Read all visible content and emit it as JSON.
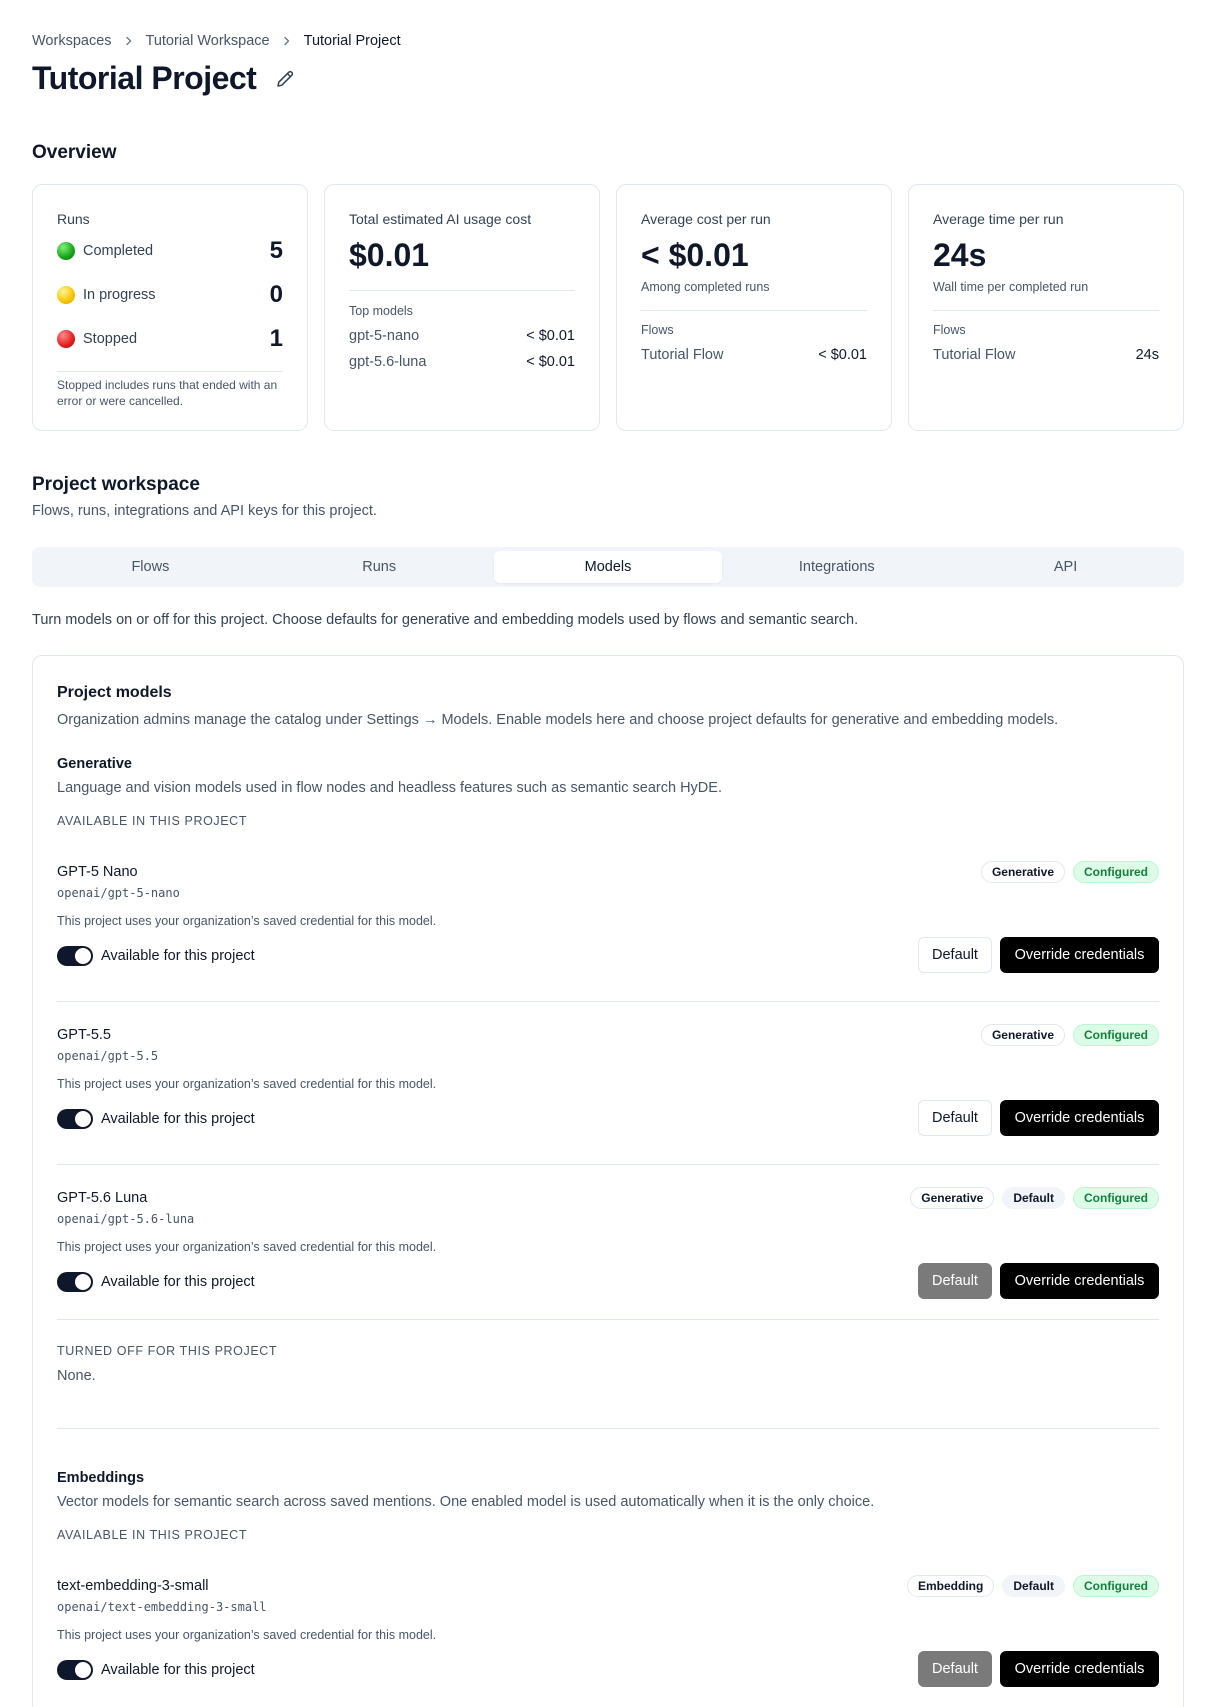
{
  "breadcrumb": {
    "items": [
      "Workspaces",
      "Tutorial Workspace"
    ],
    "current": "Tutorial Project"
  },
  "page": {
    "title": "Tutorial Project"
  },
  "overview": {
    "title": "Overview",
    "runs": {
      "label": "Runs",
      "rows": [
        {
          "label": "Completed",
          "value": "5"
        },
        {
          "label": "In progress",
          "value": "0"
        },
        {
          "label": "Stopped",
          "value": "1"
        }
      ],
      "note": "Stopped includes runs that ended with an error or were cancelled."
    },
    "total_cost": {
      "label": "Total estimated AI usage cost",
      "value": "$0.01",
      "top_models_label": "Top models",
      "models": [
        {
          "name": "gpt-5-nano",
          "value": "< $0.01"
        },
        {
          "name": "gpt-5.6-luna",
          "value": "< $0.01"
        }
      ]
    },
    "avg_cost": {
      "label": "Average cost per run",
      "value": "< $0.01",
      "note": "Among completed runs",
      "flows_label": "Flows",
      "flow": {
        "name": "Tutorial Flow",
        "value": "< $0.01"
      }
    },
    "avg_time": {
      "label": "Average time per run",
      "value": "24s",
      "note": "Wall time per completed run",
      "flows_label": "Flows",
      "flow": {
        "name": "Tutorial Flow",
        "value": "24s"
      }
    }
  },
  "workspace": {
    "title": "Project workspace",
    "subtitle": "Flows, runs, integrations and API keys for this project.",
    "tabs": [
      "Flows",
      "Runs",
      "Models",
      "Integrations",
      "API"
    ],
    "active_tab": "Models"
  },
  "models_intro": "Turn models on or off for this project. Choose defaults for generative and embedding models used by flows and semantic search.",
  "project_models": {
    "title": "Project models",
    "description": "Organization admins manage the catalog under Settings → Models. Enable models here and choose project defaults for generative and embedding models.",
    "generative": {
      "title": "Generative",
      "description": "Language and vision models used in flow nodes and headless features such as semantic search HyDE.",
      "available_label": "AVAILABLE IN THIS PROJECT",
      "models": [
        {
          "name": "GPT-5 Nano",
          "id": "openai/gpt-5-nano",
          "note": "This project uses your organization’s saved credential for this model.",
          "badges": [
            "Generative",
            "Configured"
          ],
          "toggle_label": "Available for this project",
          "default_btn": "Default",
          "override_btn": "Override credentials"
        },
        {
          "name": "GPT-5.5",
          "id": "openai/gpt-5.5",
          "note": "This project uses your organization’s saved credential for this model.",
          "badges": [
            "Generative",
            "Configured"
          ],
          "toggle_label": "Available for this project",
          "default_btn": "Default",
          "override_btn": "Override credentials"
        },
        {
          "name": "GPT-5.6 Luna",
          "id": "openai/gpt-5.6-luna",
          "note": "This project uses your organization’s saved credential for this model.",
          "badges": [
            "Generative",
            "Default",
            "Configured"
          ],
          "toggle_label": "Available for this project",
          "default_btn": "Default",
          "override_btn": "Override credentials"
        }
      ],
      "off_label": "TURNED OFF FOR THIS PROJECT",
      "off_value": "None."
    },
    "embeddings": {
      "title": "Embeddings",
      "description": "Vector models for semantic search across saved mentions. One enabled model is used automatically when it is the only choice.",
      "available_label": "AVAILABLE IN THIS PROJECT",
      "models": [
        {
          "name": "text-embedding-3-small",
          "id": "openai/text-embedding-3-small",
          "note": "This project uses your organization’s saved credential for this model.",
          "badges": [
            "Embedding",
            "Default",
            "Configured"
          ],
          "toggle_label": "Available for this project",
          "default_btn": "Default",
          "override_btn": "Override credentials"
        }
      ]
    }
  }
}
